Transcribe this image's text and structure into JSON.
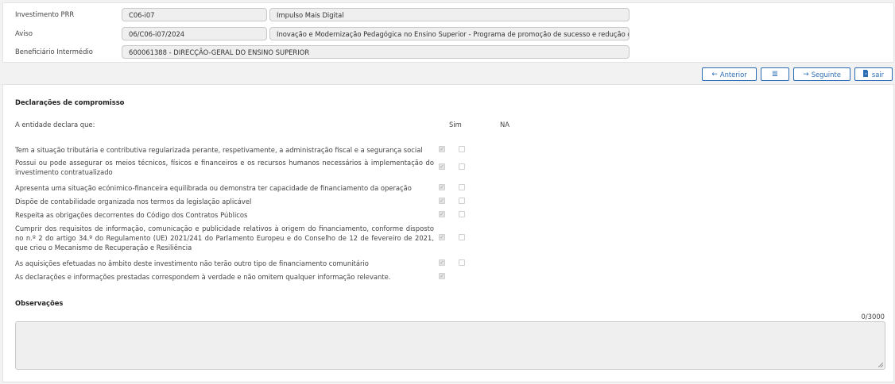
{
  "header": {
    "investimento": {
      "label": "Investimento PRR",
      "code": "C06-i07",
      "name": "Impulso Mais Digital"
    },
    "aviso": {
      "label": "Aviso",
      "code": "06/C06-i07/2024",
      "name": "Inovação e Modernização Pedagógica no Ensino Superior - Programa de promoção de sucesso e redução de a"
    },
    "beneficiario": {
      "label": "Beneficiário Intermédio",
      "value": "600061388 - DIRECÇÃO-GERAL DO ENSINO SUPERIOR"
    }
  },
  "nav": {
    "anterior": {
      "label": "Anterior",
      "icon": "arrow-left-icon"
    },
    "menu": {
      "icon": "list-icon"
    },
    "seguinte": {
      "label": "Seguinte",
      "icon": "arrow-right-icon"
    },
    "sair": {
      "label": "sair",
      "icon": "exit-door-icon"
    }
  },
  "declaracoes": {
    "title": "Declarações de compromisso",
    "intro": "A entidade declara que:",
    "col_sim": "Sim",
    "col_na": "NA",
    "items": [
      {
        "text": "Tem a situação tributária e contributiva regularizada perante, respetivamente, a administração fiscal e a segurança social",
        "sim": true,
        "na": false,
        "has_na": true
      },
      {
        "text": "Possui ou pode assegurar os meios técnicos, físicos e financeiros e os recursos humanos necessários à implementação do investimento contratualizado",
        "sim": true,
        "na": false,
        "has_na": true
      },
      {
        "text": "Apresenta uma situação ecónimico-financeira equilibrada ou demonstra ter capacidade de financiamento da operação",
        "sim": true,
        "na": false,
        "has_na": true
      },
      {
        "text": "Dispõe de contabilidade organizada nos termos da legislação aplicável",
        "sim": true,
        "na": false,
        "has_na": true
      },
      {
        "text": "Respeita as obrigações decorrentes do Código dos Contratos Públicos",
        "sim": true,
        "na": false,
        "has_na": true
      },
      {
        "text": "Cumprir dos requisitos de informação, comunicação e publicidade relativos à origem do financiamento, conforme disposto no n.º 2 do artigo 34.º do Regulamento (UE) 2021/241 do Parlamento Europeu e do Conselho de 12 de fevereiro de 2021, que criou o Mecanismo de Recuperação e Resiliência",
        "sim": true,
        "na": false,
        "has_na": true
      },
      {
        "text": "As aquisições efetuadas no âmbito deste investimento não terão outro tipo de financiamento comunitário",
        "sim": true,
        "na": false,
        "has_na": true
      },
      {
        "text": "As declarações e informações prestadas correspondem à verdade e não omitem qualquer informação relevante.",
        "sim": true,
        "na": false,
        "has_na": false
      }
    ]
  },
  "observacoes": {
    "title": "Observações",
    "counter": "0/3000",
    "value": ""
  }
}
